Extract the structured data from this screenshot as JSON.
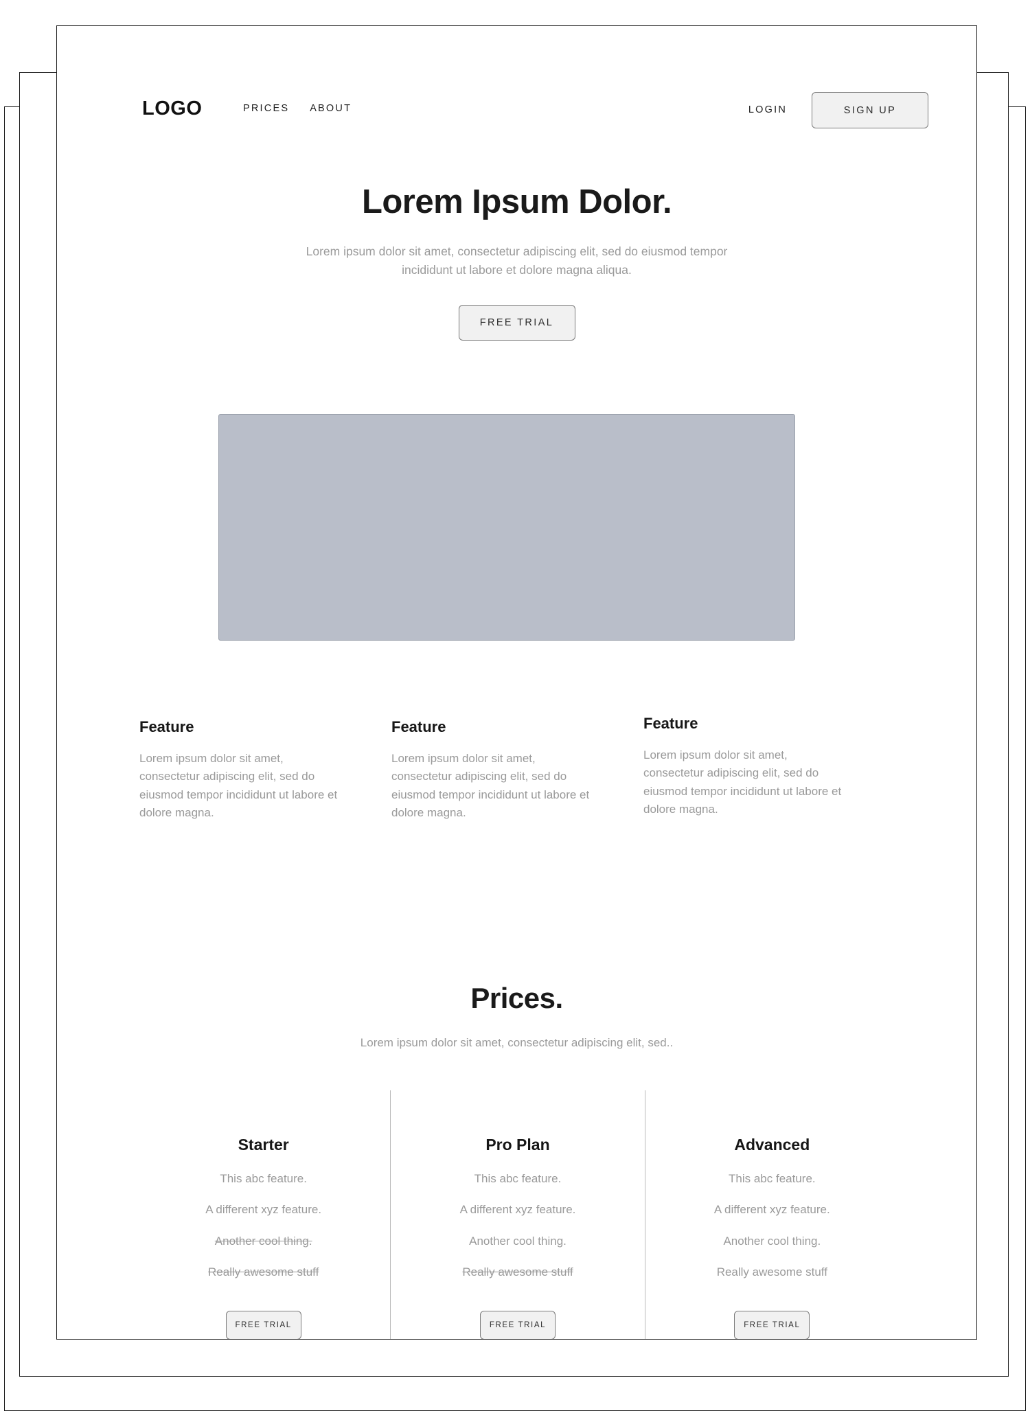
{
  "header": {
    "logo": "LOGO",
    "nav": [
      {
        "label": "PRICES"
      },
      {
        "label": "ABOUT"
      }
    ],
    "login_label": "LOGIN",
    "signup_label": "SIGN UP"
  },
  "hero": {
    "title": "Lorem Ipsum Dolor.",
    "subtitle": "Lorem ipsum dolor sit amet, consectetur adipiscing elit, sed do eiusmod tempor incididunt ut labore et dolore magna aliqua.",
    "cta_label": "FREE TRIAL"
  },
  "features": [
    {
      "title": "Feature",
      "body": "Lorem ipsum dolor sit amet, consectetur adipiscing elit, sed do eiusmod tempor incididunt ut labore et dolore magna."
    },
    {
      "title": "Feature",
      "body": "Lorem ipsum dolor sit amet, consectetur adipiscing elit, sed do eiusmod tempor incididunt ut labore et dolore magna."
    },
    {
      "title": "Feature",
      "body": "Lorem ipsum dolor sit amet, consectetur adipiscing elit, sed do eiusmod tempor incididunt ut labore et dolore magna."
    }
  ],
  "prices": {
    "title": "Prices.",
    "subtitle": "Lorem ipsum dolor sit amet, consectetur adipiscing elit, sed..",
    "plans": [
      {
        "name": "Starter",
        "features": [
          {
            "text": "This abc feature.",
            "struck": false
          },
          {
            "text": "A different xyz feature.",
            "struck": false
          },
          {
            "text": "Another cool thing.",
            "struck": true
          },
          {
            "text": "Really awesome stuff",
            "struck": true
          }
        ],
        "cta_label": "FREE TRIAL"
      },
      {
        "name": "Pro Plan",
        "features": [
          {
            "text": "This abc feature.",
            "struck": false
          },
          {
            "text": "A different xyz feature.",
            "struck": false
          },
          {
            "text": "Another cool thing.",
            "struck": false
          },
          {
            "text": "Really awesome stuff",
            "struck": true
          }
        ],
        "cta_label": "FREE TRIAL"
      },
      {
        "name": "Advanced",
        "features": [
          {
            "text": "This abc feature.",
            "struck": false
          },
          {
            "text": "A different xyz feature.",
            "struck": false
          },
          {
            "text": "Another cool thing.",
            "struck": false
          },
          {
            "text": "Really awesome stuff",
            "struck": false
          }
        ],
        "cta_label": "FREE TRIAL"
      }
    ]
  },
  "colors": {
    "text_dark": "#1a1a1a",
    "text_muted": "#9a9a9a",
    "placeholder_fill": "#b9bec9",
    "button_fill": "#f1f1f1",
    "button_border": "#7a7a7a",
    "frame_border": "#1b1b1b"
  }
}
